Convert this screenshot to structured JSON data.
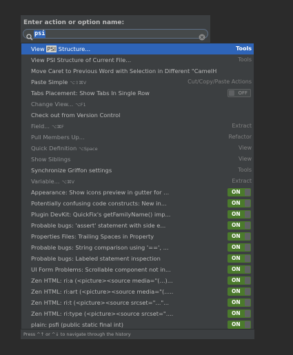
{
  "search": {
    "label": "Enter action or option name:",
    "value": "psi"
  },
  "rows": [
    {
      "pre": "View ",
      "hl": "PSI",
      "post": " Structure...",
      "shortcut": "",
      "right": "Tools",
      "kind": "text",
      "selected": true,
      "dim": false
    },
    {
      "pre": "View PSI Structure of Current File...",
      "hl": "",
      "post": "",
      "shortcut": "",
      "right": "Tools",
      "kind": "text",
      "selected": false,
      "dim": false
    },
    {
      "pre": "Move Caret to Previous Word with Selection in Different \"CamelHumps\" Mode",
      "hl": "",
      "post": "",
      "shortcut": "",
      "right": "",
      "kind": "none",
      "selected": false,
      "dim": false
    },
    {
      "pre": "Paste Simple",
      "hl": "",
      "post": "",
      "shortcut": "⌥⇧⌘V",
      "right": "Cut/Copy/Paste Actions",
      "kind": "text",
      "selected": false,
      "dim": false
    },
    {
      "pre": "Tabs Placement: Show Tabs In Single Row",
      "hl": "",
      "post": "",
      "shortcut": "",
      "right": "OFF",
      "kind": "off",
      "selected": false,
      "dim": false
    },
    {
      "pre": "Change View...",
      "hl": "",
      "post": "",
      "shortcut": "⌥F1",
      "right": "",
      "kind": "none",
      "selected": false,
      "dim": true
    },
    {
      "pre": "Check out from Version Control",
      "hl": "",
      "post": "",
      "shortcut": "",
      "right": "",
      "kind": "none",
      "selected": false,
      "dim": false
    },
    {
      "pre": "Field...",
      "hl": "",
      "post": "",
      "shortcut": "⌥⌘F",
      "right": "Extract",
      "kind": "text",
      "selected": false,
      "dim": true
    },
    {
      "pre": "Pull Members Up...",
      "hl": "",
      "post": "",
      "shortcut": "",
      "right": "Refactor",
      "kind": "text",
      "selected": false,
      "dim": true
    },
    {
      "pre": "Quick Definition",
      "hl": "",
      "post": "",
      "shortcut": "⌥Space",
      "right": "View",
      "kind": "text",
      "selected": false,
      "dim": true
    },
    {
      "pre": "Show Siblings",
      "hl": "",
      "post": "",
      "shortcut": "",
      "right": "View",
      "kind": "text",
      "selected": false,
      "dim": true
    },
    {
      "pre": "Synchronize Griffon settings",
      "hl": "",
      "post": "",
      "shortcut": "",
      "right": "Tools",
      "kind": "text",
      "selected": false,
      "dim": false
    },
    {
      "pre": "Variable...",
      "hl": "",
      "post": "",
      "shortcut": "⌥⌘V",
      "right": "Extract",
      "kind": "text",
      "selected": false,
      "dim": true
    },
    {
      "pre": "Appearance: Show icons preview in gutter for ...",
      "hl": "",
      "post": "",
      "shortcut": "",
      "right": "ON",
      "kind": "on",
      "selected": false,
      "dim": false
    },
    {
      "pre": "Potentially confusing code constructs: New in...",
      "hl": "",
      "post": "",
      "shortcut": "",
      "right": "ON",
      "kind": "on",
      "selected": false,
      "dim": false
    },
    {
      "pre": "Plugin DevKit: QuickFix's getFamilyName() imp...",
      "hl": "",
      "post": "",
      "shortcut": "",
      "right": "ON",
      "kind": "on",
      "selected": false,
      "dim": false
    },
    {
      "pre": "Probable bugs: 'assert' statement with side e...",
      "hl": "",
      "post": "",
      "shortcut": "",
      "right": "ON",
      "kind": "on",
      "selected": false,
      "dim": false
    },
    {
      "pre": "Properties Files: Trailing Spaces in Property",
      "hl": "",
      "post": "",
      "shortcut": "",
      "right": "ON",
      "kind": "on",
      "selected": false,
      "dim": false
    },
    {
      "pre": "Probable bugs: String comparison using '==', ...",
      "hl": "",
      "post": "",
      "shortcut": "",
      "right": "ON",
      "kind": "on",
      "selected": false,
      "dim": false
    },
    {
      "pre": "Probable bugs: Labeled statement inspection",
      "hl": "",
      "post": "",
      "shortcut": "",
      "right": "ON",
      "kind": "on",
      "selected": false,
      "dim": false
    },
    {
      "pre": "UI Form Problems: Scrollable component not in...",
      "hl": "",
      "post": "",
      "shortcut": "",
      "right": "ON",
      "kind": "on",
      "selected": false,
      "dim": false
    },
    {
      "pre": "Zen HTML: ri:a (<picture><source media=\"(...)...",
      "hl": "",
      "post": "",
      "shortcut": "",
      "right": "ON",
      "kind": "on",
      "selected": false,
      "dim": false
    },
    {
      "pre": "Zen HTML: ri:art (<picture><source media=\"(.....",
      "hl": "",
      "post": "",
      "shortcut": "",
      "right": "ON",
      "kind": "on",
      "selected": false,
      "dim": false
    },
    {
      "pre": "Zen HTML: ri:t (<picture><source srcset=\"...\"...",
      "hl": "",
      "post": "",
      "shortcut": "",
      "right": "ON",
      "kind": "on",
      "selected": false,
      "dim": false
    },
    {
      "pre": "Zen HTML: ri:type (<picture><source srcset=\"....",
      "hl": "",
      "post": "",
      "shortcut": "",
      "right": "ON",
      "kind": "on",
      "selected": false,
      "dim": false
    },
    {
      "pre": "plain: psfi (public static final int)",
      "hl": "",
      "post": "",
      "shortcut": "",
      "right": "ON",
      "kind": "on",
      "selected": false,
      "dim": false
    }
  ],
  "footer": {
    "hint": "Press ^↑ or ^↓ to navigate through the history"
  },
  "colors": {
    "background": "#2b2b2b",
    "popup": "#3c3f41",
    "selection": "#2e64b8",
    "toggle_on": "#4b7a2c"
  },
  "icons": {
    "search": "search-icon",
    "clear": "clear-search-icon"
  }
}
